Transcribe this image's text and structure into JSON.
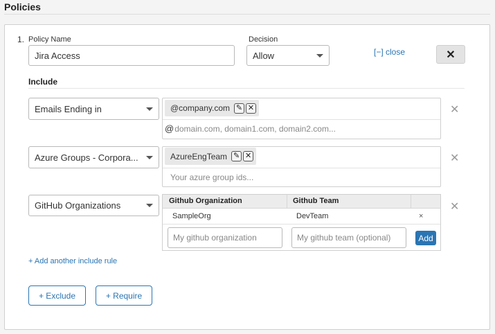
{
  "section": {
    "title": "Policies"
  },
  "policy": {
    "index": "1.",
    "name_label": "Policy Name",
    "name_value": "Jira Access",
    "decision_label": "Decision",
    "decision_value": "Allow",
    "close_link": "[−] close",
    "close_button": "✕"
  },
  "include": {
    "title": "Include",
    "rules": [
      {
        "type": "Emails Ending in",
        "tags": [
          "@company.com"
        ],
        "prefix": "@",
        "placeholder": "domain.com, domain1.com, domain2.com..."
      },
      {
        "type": "Azure Groups - Corpora...",
        "tags": [
          "AzureEngTeam"
        ],
        "placeholder": "Your azure group ids..."
      },
      {
        "type": "GitHub Organizations",
        "columns": [
          "Github Organization",
          "Github Team"
        ],
        "rows": [
          {
            "org": "SampleOrg",
            "team": "DevTeam",
            "remove": "×"
          }
        ],
        "org_placeholder": "My github organization",
        "team_placeholder": "My github team (optional)",
        "add_label": "Add"
      }
    ],
    "remove_icon": "✕",
    "add_rule_link": "+ Add another include rule"
  },
  "actions": {
    "exclude_label": "+ Exclude",
    "require_label": "+ Require"
  },
  "icons": {
    "edit": "pencil-icon",
    "remove": "close-square-icon",
    "caret": "chevron-down-icon"
  },
  "colors": {
    "accent": "#2a75b3",
    "background": "#f4f4f4"
  }
}
